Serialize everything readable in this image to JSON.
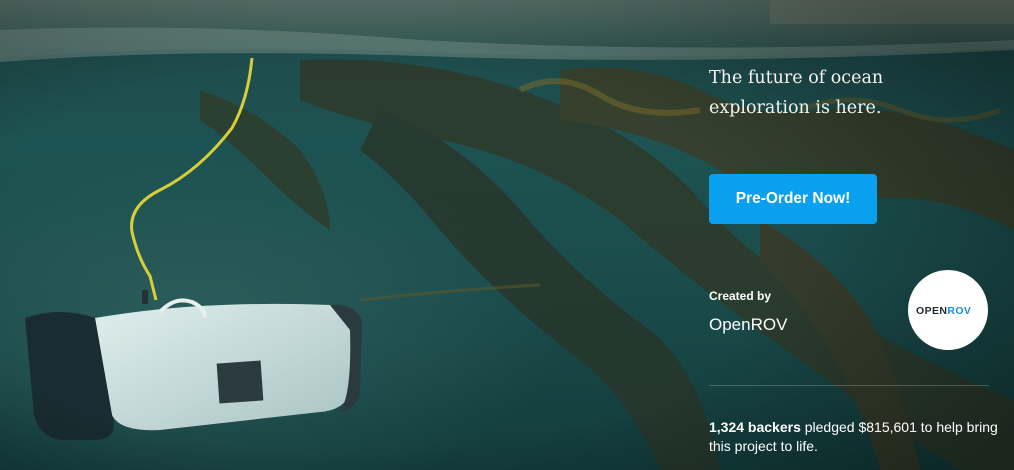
{
  "hero": {
    "tagline": "The future of ocean exploration is here.",
    "cta_label": "Pre-Order Now!"
  },
  "creator": {
    "created_by_label": "Created by",
    "name": "OpenROV",
    "logo_text_part1": "OPEN",
    "logo_text_part2": "ROV"
  },
  "stats": {
    "backers": "1,324 backers",
    "pledged_text": " pledged $815,601 to help bring this project to life."
  },
  "colors": {
    "cta": "#0aa0f0",
    "logo_accent": "#1a8fd8",
    "text": "#ffffff"
  },
  "icons": {
    "avatar": "openrov-logo"
  }
}
